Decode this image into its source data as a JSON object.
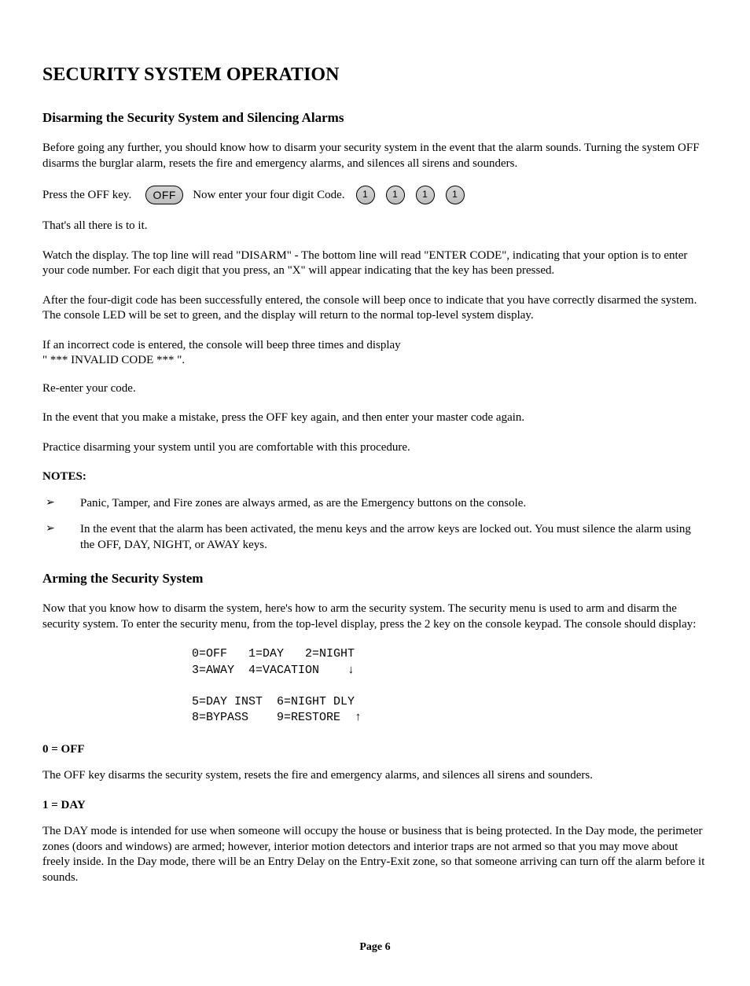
{
  "title": "SECURITY SYSTEM OPERATION",
  "section1": {
    "heading": "Disarming the Security System and Silencing Alarms",
    "p1": "Before going any further, you should know how to disarm your security system in the event that the alarm sounds.  Turning the system OFF disarms the burglar alarm, resets the fire and emergency alarms, and silences all sirens and sounders.",
    "press_off": "Press the OFF key.",
    "off_label": "OFF",
    "enter_code": "Now enter your four digit Code.",
    "digit": "1",
    "p2": "That's all there is to it.",
    "p3": "Watch the display.  The top line will read \"DISARM\" - The bottom line will read \"ENTER CODE\", indicating that your option is to enter your code number.  For each digit that you press, an \"X\" will appear indicating that the key has been pressed.",
    "p4": "After the four-digit code has been successfully entered, the console will beep once to indicate that you have correctly disarmed the system.  The console LED will be set to green, and the display will return to the normal top-level system display.",
    "p5a": "If an incorrect code is entered, the console will beep three times and display",
    "p5b": "\" *** INVALID CODE *** \".",
    "p6": "Re-enter your code.",
    "p7": "In the event that you make a mistake, press the OFF key again, and then enter your master code again.",
    "p8": "Practice disarming your system until you are comfortable with this procedure.",
    "notes_label": "NOTES:",
    "note1": "Panic, Tamper, and Fire zones are always armed, as are the Emergency buttons on the console.",
    "note2": "In the event that the alarm has been activated, the menu keys and the arrow keys are locked out.  You must silence the alarm using the OFF, DAY, NIGHT, or AWAY keys."
  },
  "section2": {
    "heading": "Arming the Security System",
    "p1": "Now that you know how to disarm the system, here's how to arm the security system.  The security menu is used to arm and disarm the security system.  To enter the security menu, from the top-level display, press the 2 key on the console keypad.  The console should display:",
    "display": "0=OFF   1=DAY   2=NIGHT\n3=AWAY  4=VACATION    ↓\n\n5=DAY INST  6=NIGHT DLY\n8=BYPASS    9=RESTORE  ↑",
    "mode0_label": "0 = OFF",
    "mode0_text": "The OFF key disarms the security system, resets the fire and emergency alarms, and silences all sirens and sounders.",
    "mode1_label": "1 = DAY",
    "mode1_text": "The DAY mode is intended for use when someone will occupy the house or business that is being protected.  In the Day mode, the perimeter zones (doors and windows) are armed; however, interior motion detectors and interior traps are not armed so that you may move about freely inside.  In the Day mode, there will be an Entry Delay on the Entry-Exit zone, so that someone arriving can turn off the alarm before it sounds."
  },
  "footer": "Page 6"
}
